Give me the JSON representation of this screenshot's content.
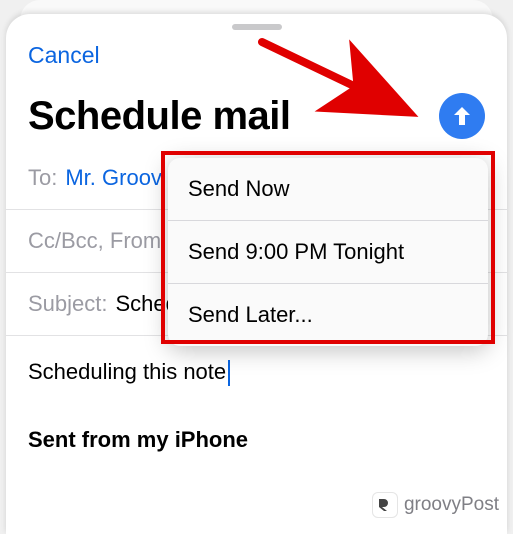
{
  "header": {
    "cancel": "Cancel",
    "title": "Schedule mail"
  },
  "fields": {
    "to_label": "To:",
    "to_value": "Mr. Groov",
    "ccbcc_label": "Cc/Bcc, From",
    "subject_label": "Subject:",
    "subject_value": "Schedule mail"
  },
  "body": {
    "text": "Scheduling this note",
    "signature": "Sent from my iPhone"
  },
  "menu": {
    "items": [
      "Send Now",
      "Send 9:00 PM Tonight",
      "Send Later..."
    ]
  },
  "watermark": "groovyPost"
}
